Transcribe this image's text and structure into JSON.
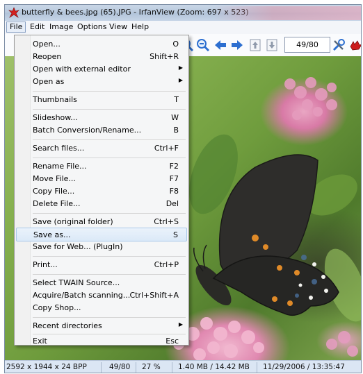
{
  "window": {
    "title": "butterfly & bees.jpg (65).JPG - IrfanView (Zoom: 697 x 523)"
  },
  "menubar": {
    "items": [
      "File",
      "Edit",
      "Image",
      "Options",
      "View",
      "Help"
    ]
  },
  "toolbar": {
    "page_indicator": "49/80",
    "icons": [
      "zoom-in-icon",
      "zoom-out-icon",
      "previous-arrow-icon",
      "next-arrow-icon",
      "first-page-icon",
      "last-page-icon",
      "tools-icon",
      "irfanview-cat-icon"
    ]
  },
  "file_menu": {
    "items": [
      {
        "label": "Open...",
        "shortcut": "O"
      },
      {
        "label": "Reopen",
        "shortcut": "Shift+R"
      },
      {
        "label": "Open with external editor",
        "submenu": true
      },
      {
        "label": "Open as",
        "submenu": true
      },
      {
        "label": "Thumbnails",
        "shortcut": "T"
      },
      {
        "label": "Slideshow...",
        "shortcut": "W"
      },
      {
        "label": "Batch Conversion/Rename...",
        "shortcut": "B"
      },
      {
        "label": "Search files...",
        "shortcut": "Ctrl+F"
      },
      {
        "label": "Rename File...",
        "shortcut": "F2"
      },
      {
        "label": "Move File...",
        "shortcut": "F7"
      },
      {
        "label": "Copy File...",
        "shortcut": "F8"
      },
      {
        "label": "Delete File...",
        "shortcut": "Del"
      },
      {
        "label": "Save (original folder)",
        "shortcut": "Ctrl+S"
      },
      {
        "label": "Save as...",
        "shortcut": "S",
        "highlighted": true
      },
      {
        "label": "Save for Web... (PlugIn)"
      },
      {
        "label": "Print...",
        "shortcut": "Ctrl+P"
      },
      {
        "label": "Select TWAIN Source..."
      },
      {
        "label": "Acquire/Batch scanning...",
        "shortcut": "Ctrl+Shift+A"
      },
      {
        "label": "Copy Shop..."
      },
      {
        "label": "Recent directories",
        "submenu": true
      },
      {
        "label": "Exit",
        "shortcut": "Esc"
      }
    ]
  },
  "statusbar": {
    "dimensions": "2592 x 1944 x 24 BPP",
    "position": "49/80",
    "zoom": "27 %",
    "size": "1.40 MB / 14.42 MB",
    "datetime": "11/29/2006 / 13:35:47"
  },
  "colors": {
    "menu_highlight": "#dbe9f8",
    "statusbar_bg": "#dbe6f4",
    "arrow_blue": "#2d6fd0"
  }
}
